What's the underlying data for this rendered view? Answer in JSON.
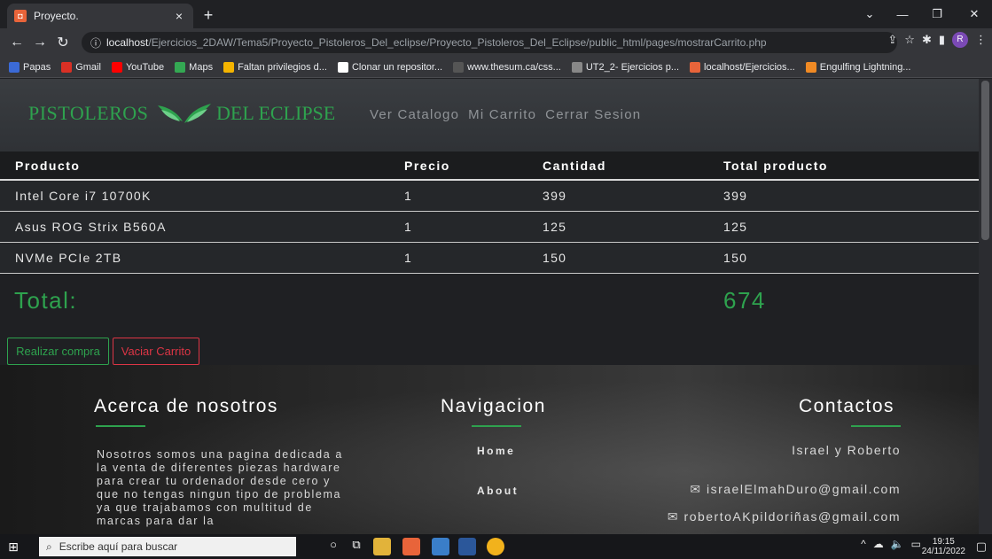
{
  "browser": {
    "tab_title": "Proyecto.",
    "tab_close": "×",
    "new_tab": "+",
    "url_host": "localhost",
    "url_path": "/Ejercicios_2DAW/Tema5/Proyecto_Pistoleros_Del_eclipse/Proyecto_Pistoleros_Del_Eclipse/public_html/pages/mostrarCarrito.php",
    "profile_initial": "R",
    "bookmarks": [
      {
        "label": "Papas",
        "color": "#3b6ad6"
      },
      {
        "label": "Gmail",
        "color": "#d93025"
      },
      {
        "label": "YouTube",
        "color": "#ff0000"
      },
      {
        "label": "Maps",
        "color": "#34a853"
      },
      {
        "label": "Faltan privilegios d...",
        "color": "#f4b400"
      },
      {
        "label": "Clonar un repositor...",
        "color": "#ffffff"
      },
      {
        "label": "www.thesum.ca/css...",
        "color": "#555555"
      },
      {
        "label": "UT2_2- Ejercicios p...",
        "color": "#888888"
      },
      {
        "label": "localhost/Ejercicios...",
        "color": "#e8643a"
      },
      {
        "label": "Engulfing Lightning...",
        "color": "#f08a24"
      }
    ]
  },
  "site": {
    "brand_left": "PISTOLEROS",
    "brand_right": "DEL ECLIPSE",
    "nav": [
      "Ver Catalogo",
      "Mi Carrito",
      "Cerrar Sesion"
    ]
  },
  "cart": {
    "headers": [
      "Producto",
      "Precio",
      "Cantidad",
      "Total producto"
    ],
    "rows": [
      [
        "Intel Core i7 10700K",
        "1",
        "399",
        "399"
      ],
      [
        "Asus ROG Strix B560A",
        "1",
        "125",
        "125"
      ],
      [
        "NVMe PCIe 2TB",
        "1",
        "150",
        "150"
      ]
    ],
    "total_label": "Total:",
    "total_value": "674",
    "buy_label": "Realizar compra",
    "empty_label": "Vaciar Carrito"
  },
  "footer": {
    "about_title": "Acerca de nosotros",
    "about_text": "Nosotros somos una pagina dedicada a la venta de diferentes piezas hardware para crear tu ordenador desde cero y que no tengas ningun tipo de problema ya que trajabamos con multitud de marcas para dar la",
    "nav_title": "Navigacion",
    "nav_items": [
      "Home",
      "About"
    ],
    "contact_title": "Contactos",
    "contact_names": "Israel y Roberto",
    "emails": [
      "israelElmahDuro@gmail.com",
      "robertoAKpildoriñas@gmail.com"
    ]
  },
  "taskbar": {
    "search_placeholder": "Escribe aquí para buscar",
    "time": "19:15",
    "date": "24/11/2022"
  },
  "colors": {
    "accent": "#2ea24e",
    "danger": "#dc3545"
  }
}
